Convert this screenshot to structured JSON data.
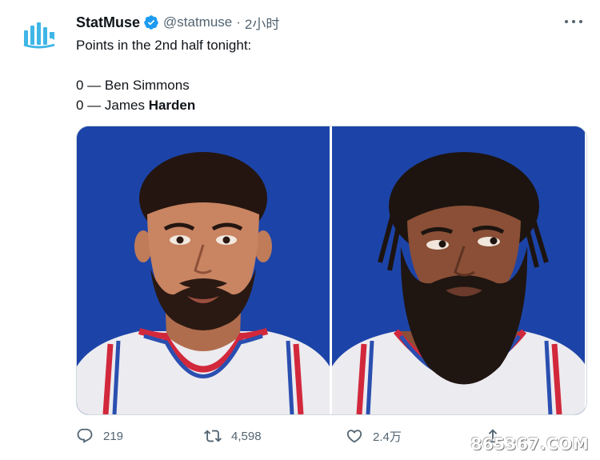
{
  "tweet": {
    "display_name": "StatMuse",
    "handle": "@statmuse",
    "separator": "·",
    "time": "2小时",
    "lines": [
      "Points in the 2nd half tonight:",
      "",
      "0 — Ben Simmons",
      "0 — James "
    ],
    "bold_suffix": "Harden"
  },
  "media": [
    {
      "subject": "Ben Simmons illustration"
    },
    {
      "subject": "James Harden illustration"
    }
  ],
  "actions": {
    "reply_count": "219",
    "retweet_count": "4,598",
    "like_count": "2.4万",
    "share_count": ""
  },
  "watermark": "865367.COM",
  "colors": {
    "brand": "#1d9bf0",
    "logo": "#3fb6e6",
    "background_art": "#1c44a8",
    "jersey_red": "#d2283c",
    "jersey_blue": "#2a4fb0"
  },
  "icons": [
    "statmuse-logo-icon",
    "verified-badge-icon",
    "more-icon",
    "reply-icon",
    "retweet-icon",
    "like-icon",
    "share-icon"
  ]
}
